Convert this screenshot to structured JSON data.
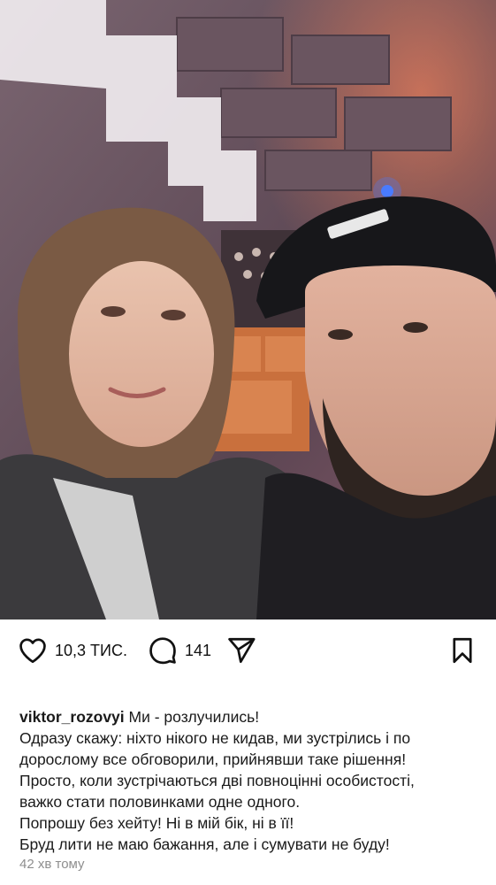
{
  "post": {
    "likes_count": "10,3 ТИС.",
    "comments_count": "141",
    "username": "viktor_rozovyi",
    "caption_first": "Ми - розлучились!",
    "caption_lines": [
      "Одразу скажу: ніхто нікого не кидав, ми зустрілись і по",
      "дорослому все обговорили,  прийнявши таке рішення!",
      "Просто, коли зустрічаються дві повноцінні особистості,",
      "важко стати половинками одне одного.",
      "Попрошу без хейту! Ні в мій бік, ні в її!",
      "Бруд лити не маю бажання, але і сумувати не буду!"
    ],
    "timestamp": "42 хв тому"
  },
  "icons": {
    "like": "heart-icon",
    "comment": "speech-bubble-icon",
    "share": "paper-plane-icon",
    "save": "bookmark-icon"
  },
  "colors": {
    "text": "#111111",
    "muted": "#8e8e8e",
    "background": "#ffffff"
  }
}
